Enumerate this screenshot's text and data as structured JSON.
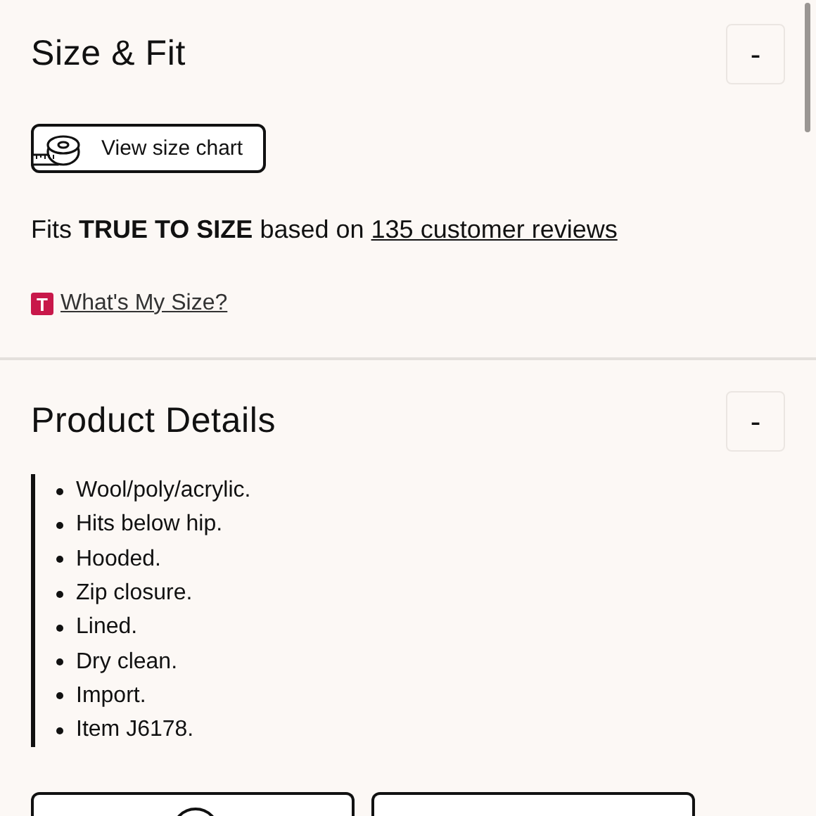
{
  "size_fit": {
    "title": "Size & Fit",
    "expanded": true,
    "toggle_label": "-",
    "size_chart_button": "View size chart",
    "fit_text": "Fits **TRUE TO SIZE** based on",
    "reviews_link": "135 customer reviews",
    "whats_my_size": {
      "badge": "T",
      "link": "What's My Size?"
    }
  },
  "product_details": {
    "title": "Product Details",
    "expanded": true,
    "toggle_label": "-",
    "items": [
      "Wool/poly/acrylic.",
      "Hits below hip.",
      "Hooded.",
      "Zip closure.",
      "Lined.",
      "Dry clean.",
      "Import.",
      "Item J6178."
    ]
  },
  "bottom_cards": [
    {
      "kind": "icon"
    },
    {
      "kind": "plain"
    }
  ]
}
